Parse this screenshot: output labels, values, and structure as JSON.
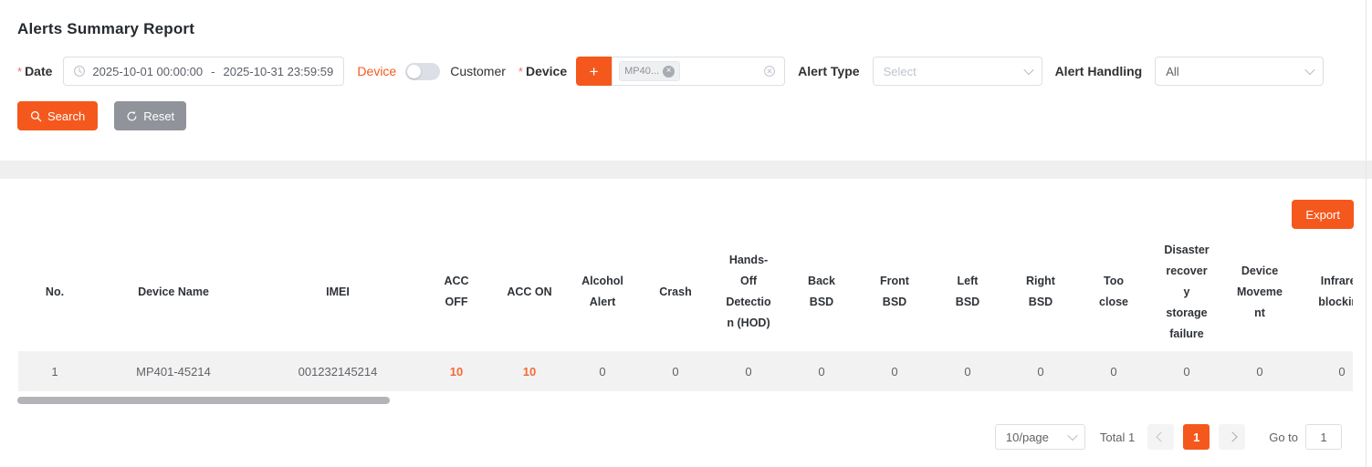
{
  "colors": {
    "accent": "#f5581d",
    "value_accent": "#f56a35",
    "reset_gray": "#909399"
  },
  "header": {
    "title": "Alerts Summary Report"
  },
  "filters": {
    "date": {
      "required_mark": "*",
      "label": "Date",
      "start": "2025-10-01 00:00:00",
      "separator": "-",
      "end": "2025-10-31 23:59:59"
    },
    "mode_toggle": {
      "left_label": "Device",
      "right_label": "Customer"
    },
    "device": {
      "required_mark": "*",
      "label": "Device",
      "add_label": "+",
      "tag": "MP40...",
      "tag_close": "×"
    },
    "alert_type": {
      "label": "Alert Type",
      "placeholder": "Select"
    },
    "alert_handling": {
      "label": "Alert Handling",
      "value": "All"
    }
  },
  "actions": {
    "search": "Search",
    "reset": "Reset",
    "export": "Export"
  },
  "table": {
    "columns": [
      "No.",
      "Device Name",
      "IMEI",
      "ACC OFF",
      "ACC ON",
      "Alcohol Alert",
      "Crash",
      "Hands-Off Detection (HOD)",
      "Back BSD",
      "Front BSD",
      "Left BSD",
      "Right BSD",
      "Too close",
      "Disaster recovery storage failure",
      "Device Movement",
      "Infrared blocking"
    ],
    "rows": [
      [
        "1",
        "MP401-45214",
        "001232145214",
        "10",
        "10",
        "0",
        "0",
        "0",
        "0",
        "0",
        "0",
        "0",
        "0",
        "0",
        "0",
        "0"
      ]
    ]
  },
  "pagination": {
    "page_size": "10/page",
    "total": "Total 1",
    "current_page": "1",
    "goto_label": "Go to",
    "goto_value": "1"
  },
  "icons": {
    "date": "clock-icon",
    "tag_close": "close-icon",
    "device_clear": "circle-close-icon",
    "select_caret": "chevron-down-icon",
    "search": "search-icon",
    "reset": "refresh-icon",
    "prev": "chevron-left-icon",
    "next": "chevron-right-icon"
  }
}
